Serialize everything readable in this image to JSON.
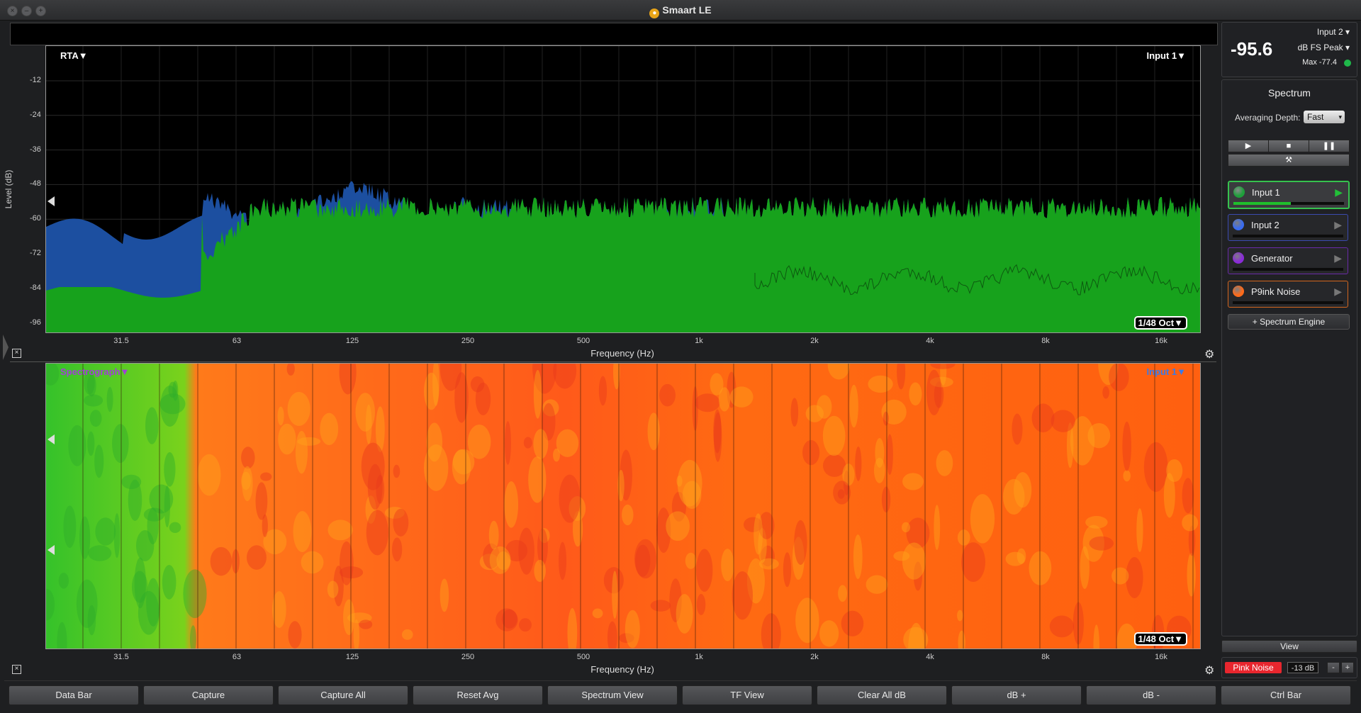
{
  "window": {
    "title": "Smaart LE"
  },
  "rta": {
    "mode_label": "RTA▼",
    "input_label": "Input 1▼",
    "y_axis_label": "Level (dB)",
    "y_ticks": [
      "-12",
      "-24",
      "-36",
      "-48",
      "-60",
      "-72",
      "-84",
      "-96"
    ],
    "x_ticks": [
      "31.5",
      "63",
      "125",
      "250",
      "500",
      "1k",
      "2k",
      "4k",
      "8k",
      "16k"
    ],
    "x_axis_label": "Frequency (Hz)",
    "resolution": "1/48 Oct▼"
  },
  "spectrograph": {
    "mode_label": "Spectrograph▼",
    "input_label": "Input 1▼",
    "x_ticks": [
      "31.5",
      "63",
      "125",
      "250",
      "500",
      "1k",
      "2k",
      "4k",
      "8k",
      "16k"
    ],
    "x_axis_label": "Frequency (Hz)",
    "resolution": "1/48 Oct▼"
  },
  "meter": {
    "value": "-95.6",
    "input": "Input 2",
    "unit": "dB FS Peak",
    "max": "Max -77.4",
    "status_color": "#1fb84a"
  },
  "spectrum_panel": {
    "title": "Spectrum",
    "averaging_label": "Averaging Depth:",
    "averaging_value": "Fast",
    "play_icon": "▶",
    "stop_icon": "■",
    "pause_icon": "❚❚",
    "tools_icon": "⚒",
    "sources": [
      {
        "name": "Input 1",
        "color": "#1ea03a",
        "border": "#36c24e",
        "meter": 0.52
      },
      {
        "name": "Input 2",
        "color": "#3a6cf0",
        "border": "#3b4ab0",
        "meter": 0
      },
      {
        "name": "Generator",
        "color": "#8a2bd8",
        "border": "#6a2aa8",
        "meter": 0
      },
      {
        "name": "P9ink Noise",
        "color": "#ff6a1a",
        "border": "#d4661e",
        "meter": 0
      }
    ],
    "add_engine": "+ Spectrum Engine"
  },
  "view_label": "View",
  "generator": {
    "label": "Pink Noise",
    "level": "-13 dB",
    "minus": "-",
    "plus": "+"
  },
  "bottom_buttons": [
    "Data Bar",
    "Capture",
    "Capture All",
    "Reset Avg",
    "Spectrum View",
    "TF View",
    "Clear All dB",
    "dB +",
    "dB -",
    "Ctrl Bar"
  ]
}
